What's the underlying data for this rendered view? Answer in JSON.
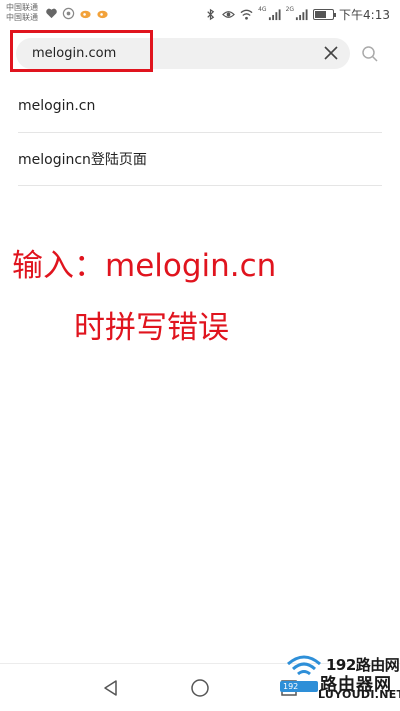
{
  "status_bar": {
    "carrier_1": "中国联通",
    "carrier_2": "中国联通",
    "network_1": "4G",
    "network_2": "2G",
    "battery_level": 0.7,
    "time": "下午4:13"
  },
  "search": {
    "value": "melogin.com"
  },
  "suggestions": [
    {
      "label": "melogin.cn"
    },
    {
      "label": "melogincn登陆页面"
    }
  ],
  "annotation": {
    "line1": "输入：melogin.cn",
    "line2": "时拼写错误"
  },
  "watermark": {
    "title": "192路由网",
    "subtitle": "路由器网",
    "ip_badge": "192",
    "url": "LUYOUDI.NET"
  },
  "colors": {
    "highlight": "#e0141e",
    "annotation": "#e0141e",
    "pill_bg": "#f0f0f0",
    "watermark_blue": "#2e8fd8"
  }
}
